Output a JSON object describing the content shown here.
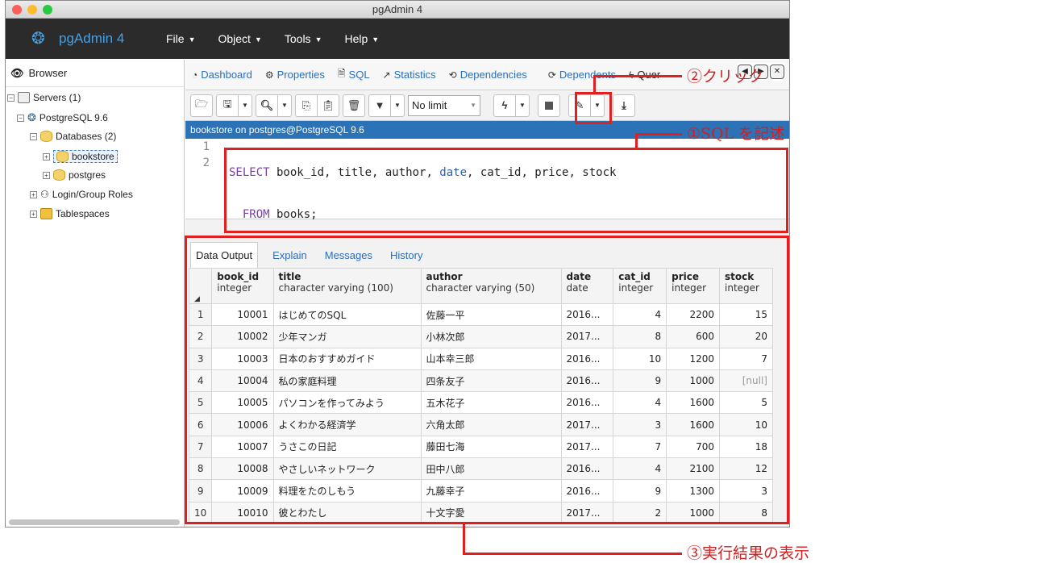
{
  "window": {
    "title": "pgAdmin 4"
  },
  "menubar": {
    "brand": "pgAdmin 4",
    "items": [
      "File",
      "Object",
      "Tools",
      "Help"
    ]
  },
  "browser": {
    "header": "Browser",
    "servers": "Servers (1)",
    "server": "PostgreSQL 9.6",
    "databases": "Databases (2)",
    "db1": "bookstore",
    "db2": "postgres",
    "roles": "Login/Group Roles",
    "tablespaces": "Tablespaces"
  },
  "tabs": {
    "dashboard": "Dashboard",
    "properties": "Properties",
    "sql": "SQL",
    "statistics": "Statistics",
    "dependencies": "Dependencies",
    "dependents": "Dependents",
    "query": "Quer"
  },
  "toolbar": {
    "limit": "No limit"
  },
  "connection": "bookstore on postgres@PostgreSQL 9.6",
  "editor": {
    "line1_no": "1",
    "line2_no": "2",
    "kw_select": "SELECT",
    "cols_a": " book_id, title, author, ",
    "col_date": "date",
    "cols_b": ", cat_id, price, stock",
    "indent": "  ",
    "kw_from": "FROM",
    "from_rest": " books;"
  },
  "results": {
    "tabs": [
      "Data Output",
      "Explain",
      "Messages",
      "History"
    ],
    "columns": [
      {
        "name": "book_id",
        "type": "integer"
      },
      {
        "name": "title",
        "type": "character varying (100)"
      },
      {
        "name": "author",
        "type": "character varying (50)"
      },
      {
        "name": "date",
        "type": "date"
      },
      {
        "name": "cat_id",
        "type": "integer"
      },
      {
        "name": "price",
        "type": "integer"
      },
      {
        "name": "stock",
        "type": "integer"
      }
    ],
    "rows": [
      [
        "1",
        "10001",
        "はじめてのSQL",
        "佐藤一平",
        "2016...",
        "4",
        "2200",
        "15"
      ],
      [
        "2",
        "10002",
        "少年マンガ",
        "小林次郎",
        "2017...",
        "8",
        "600",
        "20"
      ],
      [
        "3",
        "10003",
        "日本のおすすめガイド",
        "山本幸三郎",
        "2016...",
        "10",
        "1200",
        "7"
      ],
      [
        "4",
        "10004",
        "私の家庭料理",
        "四条友子",
        "2016...",
        "9",
        "1000",
        "[null]"
      ],
      [
        "5",
        "10005",
        "パソコンを作ってみよう",
        "五木花子",
        "2016...",
        "4",
        "1600",
        "5"
      ],
      [
        "6",
        "10006",
        "よくわかる経済学",
        "六角太郎",
        "2017...",
        "3",
        "1600",
        "10"
      ],
      [
        "7",
        "10007",
        "うさこの日記",
        "藤田七海",
        "2017...",
        "7",
        "700",
        "18"
      ],
      [
        "8",
        "10008",
        "やさしいネットワーク",
        "田中八郎",
        "2016...",
        "4",
        "2100",
        "12"
      ],
      [
        "9",
        "10009",
        "料理をたのしもう",
        "九藤幸子",
        "2016...",
        "9",
        "1300",
        "3"
      ],
      [
        "10",
        "10010",
        "彼とわたし",
        "十文字愛",
        "2017...",
        "2",
        "1000",
        "8"
      ]
    ]
  },
  "annotations": {
    "click": "②クリック",
    "write_sql": "①SQL を記述",
    "show_result": "③実行結果の表示"
  },
  "colors": {
    "accent": "#2c72b6",
    "highlight": "#e02020",
    "menubar": "#2b2b2b"
  }
}
